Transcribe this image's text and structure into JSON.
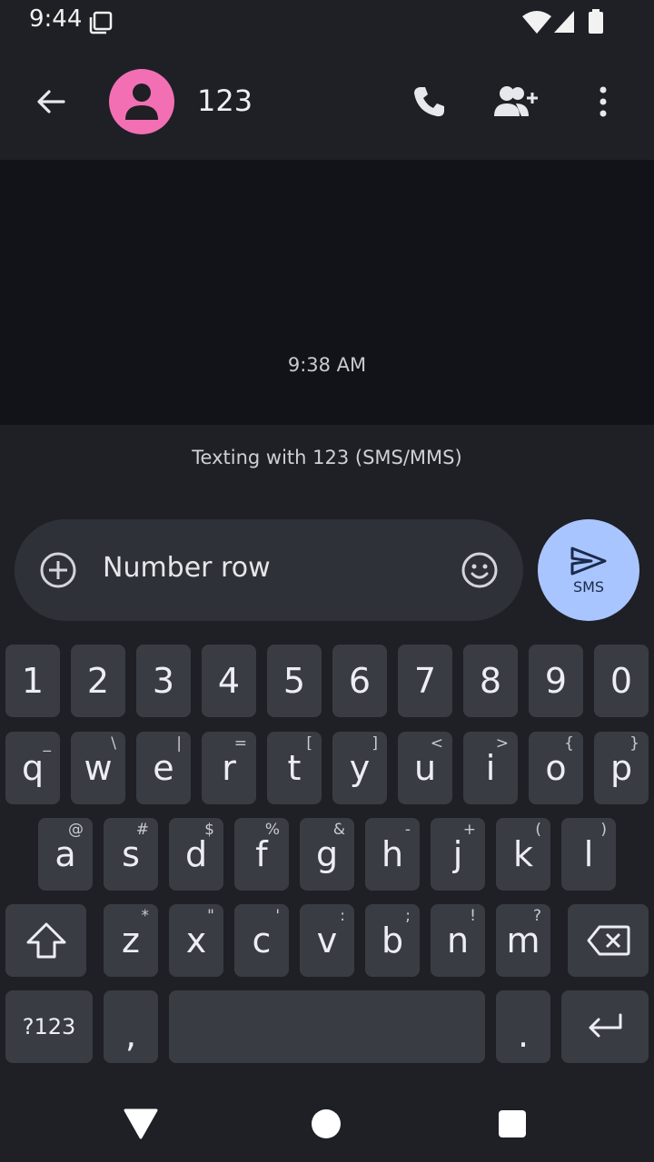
{
  "status_bar": {
    "time": "9:44"
  },
  "app_bar": {
    "contact_name": "123"
  },
  "thread": {
    "message_time": "9:38 AM"
  },
  "info_bar": {
    "text": "Texting with 123 (SMS/MMS)"
  },
  "compose": {
    "text": "Number row",
    "send_label": "SMS"
  },
  "keyboard": {
    "number_row": [
      "1",
      "2",
      "3",
      "4",
      "5",
      "6",
      "7",
      "8",
      "9",
      "0"
    ],
    "row1": [
      {
        "k": "q",
        "h": "_"
      },
      {
        "k": "w",
        "h": "\\"
      },
      {
        "k": "e",
        "h": "|"
      },
      {
        "k": "r",
        "h": "="
      },
      {
        "k": "t",
        "h": "["
      },
      {
        "k": "y",
        "h": "]"
      },
      {
        "k": "u",
        "h": "<"
      },
      {
        "k": "i",
        "h": ">"
      },
      {
        "k": "o",
        "h": "{"
      },
      {
        "k": "p",
        "h": "}"
      }
    ],
    "row2": [
      {
        "k": "a",
        "h": "@"
      },
      {
        "k": "s",
        "h": "#"
      },
      {
        "k": "d",
        "h": "$"
      },
      {
        "k": "f",
        "h": "%"
      },
      {
        "k": "g",
        "h": "&"
      },
      {
        "k": "h",
        "h": "-"
      },
      {
        "k": "j",
        "h": "+"
      },
      {
        "k": "k",
        "h": "("
      },
      {
        "k": "l",
        "h": ")"
      }
    ],
    "row3": [
      {
        "k": "z",
        "h": "*"
      },
      {
        "k": "x",
        "h": "\""
      },
      {
        "k": "c",
        "h": "'"
      },
      {
        "k": "v",
        "h": ":"
      },
      {
        "k": "b",
        "h": ";"
      },
      {
        "k": "n",
        "h": "!"
      },
      {
        "k": "m",
        "h": "?"
      }
    ],
    "symbols_key": "?123",
    "comma_key": ",",
    "period_key": "."
  }
}
